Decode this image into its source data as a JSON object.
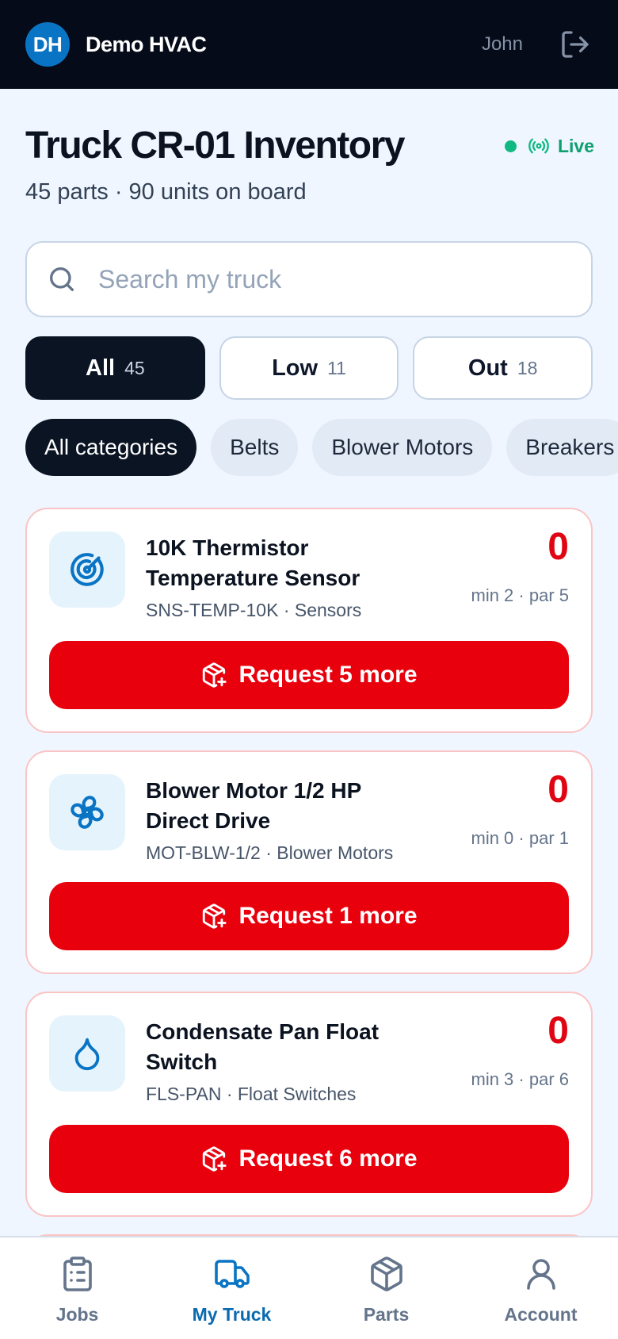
{
  "header": {
    "logo_initials": "DH",
    "company": "Demo HVAC",
    "user": "John",
    "logout_icon": "logout-icon"
  },
  "page": {
    "title": "Truck CR-01 Inventory",
    "subtitle": "45 parts · 90 units on board",
    "status": "Live",
    "status_color": "#10b981"
  },
  "search": {
    "placeholder": "Search my truck",
    "value": ""
  },
  "filters": [
    {
      "label": "All",
      "count": "45",
      "active": true
    },
    {
      "label": "Low",
      "count": "11",
      "active": false
    },
    {
      "label": "Out",
      "count": "18",
      "active": false
    }
  ],
  "categories": [
    "All categories",
    "Belts",
    "Blower Motors",
    "Breakers"
  ],
  "items": [
    {
      "name": "10K Thermistor Temperature Sensor",
      "meta": "SNS-TEMP-10K · Sensors",
      "qty": "0",
      "minpar": "min 2 · par 5",
      "action": "Request 5 more",
      "icon": "sensor-icon"
    },
    {
      "name": "Blower Motor 1/2 HP Direct Drive",
      "meta": "MOT-BLW-1/2 · Blower Motors",
      "qty": "0",
      "minpar": "min 0 · par 1",
      "action": "Request 1 more",
      "icon": "fan-icon"
    },
    {
      "name": "Condensate Pan Float Switch",
      "meta": "FLS-PAN · Float Switches",
      "qty": "0",
      "minpar": "min 3 · par 6",
      "action": "Request 6 more",
      "icon": "droplet-icon"
    }
  ],
  "nav": [
    {
      "label": "Jobs",
      "icon": "clipboard-icon",
      "active": false
    },
    {
      "label": "My Truck",
      "icon": "truck-icon",
      "active": true
    },
    {
      "label": "Parts",
      "icon": "box-icon",
      "active": false
    },
    {
      "label": "Account",
      "icon": "user-icon",
      "active": false
    }
  ],
  "colors": {
    "accent": "#0a74c4",
    "danger": "#e8000d",
    "dark": "#050b18"
  }
}
